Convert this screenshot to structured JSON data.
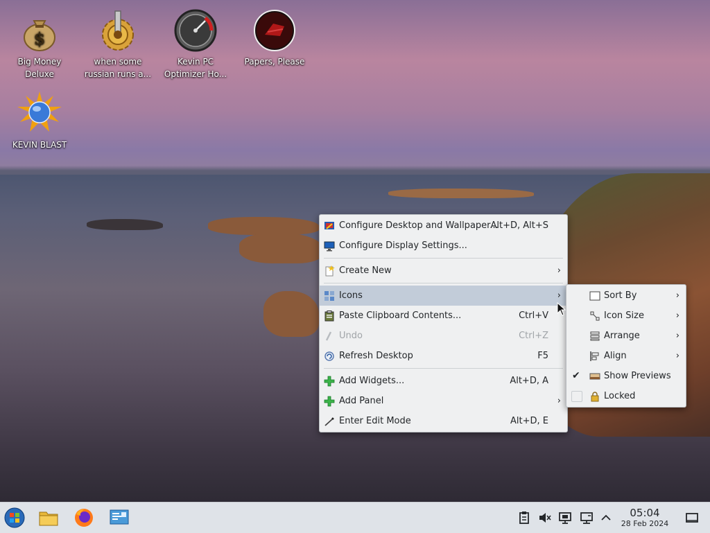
{
  "desktop": {
    "icons": [
      {
        "label": "Big Money Deluxe"
      },
      {
        "label": "when some russian runs a..."
      },
      {
        "label": "Kevin PC Optimizer Ho..."
      },
      {
        "label": "Papers, Please"
      },
      {
        "label": "KEVIN BLAST"
      }
    ]
  },
  "context_menu": {
    "items": [
      {
        "label": "Configure Desktop and Wallpaper...",
        "shortcut": "Alt+D, Alt+S"
      },
      {
        "label": "Configure Display Settings...",
        "shortcut": ""
      },
      {
        "label": "Create New",
        "shortcut": ""
      },
      {
        "label": "Icons",
        "shortcut": ""
      },
      {
        "label": "Paste Clipboard Contents...",
        "shortcut": "Ctrl+V"
      },
      {
        "label": "Undo",
        "shortcut": "Ctrl+Z"
      },
      {
        "label": "Refresh Desktop",
        "shortcut": "F5"
      },
      {
        "label": "Add Widgets...",
        "shortcut": "Alt+D, A"
      },
      {
        "label": "Add Panel",
        "shortcut": ""
      },
      {
        "label": "Enter Edit Mode",
        "shortcut": "Alt+D, E"
      }
    ]
  },
  "icons_submenu": {
    "items": [
      {
        "label": "Sort By"
      },
      {
        "label": "Icon Size"
      },
      {
        "label": "Arrange"
      },
      {
        "label": "Align"
      },
      {
        "label": "Show Previews",
        "checked": true
      },
      {
        "label": "Locked",
        "checked": false
      }
    ]
  },
  "taskbar": {
    "clock_time": "05:04",
    "clock_date": "28 Feb 2024"
  },
  "colors": {
    "menu_bg": "#eff0f1",
    "highlight": "#c2ccd9",
    "taskbar_bg": "#dfe3e8"
  }
}
